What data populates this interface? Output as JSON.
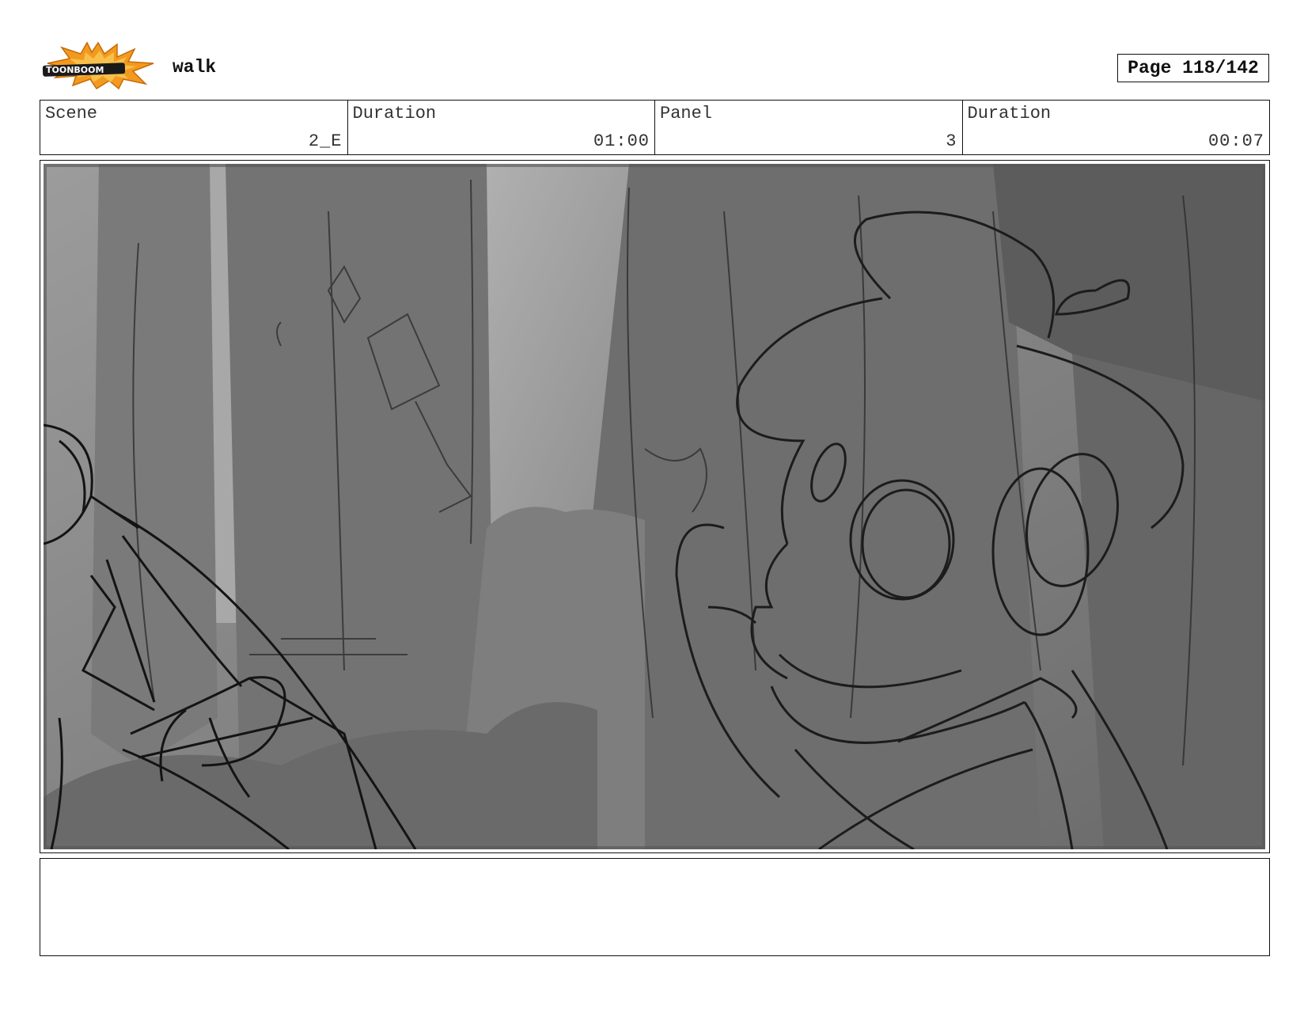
{
  "header": {
    "logo_text": "TOONBOOM",
    "title": "walk",
    "page_label": "Page 118/142"
  },
  "info": {
    "scene_label": "Scene",
    "scene_value": "2_E",
    "scene_duration_label": "Duration",
    "scene_duration_value": "01:00",
    "panel_label": "Panel",
    "panel_value": "3",
    "panel_duration_label": "Duration",
    "panel_duration_value": "00:07"
  },
  "notes": {
    "text": ""
  },
  "colors": {
    "logo_orange": "#f29a1f",
    "logo_dark": "#1a1a1a",
    "sketch_line": "#1c1c1c"
  },
  "icons": [
    "toonboom-logo"
  ]
}
